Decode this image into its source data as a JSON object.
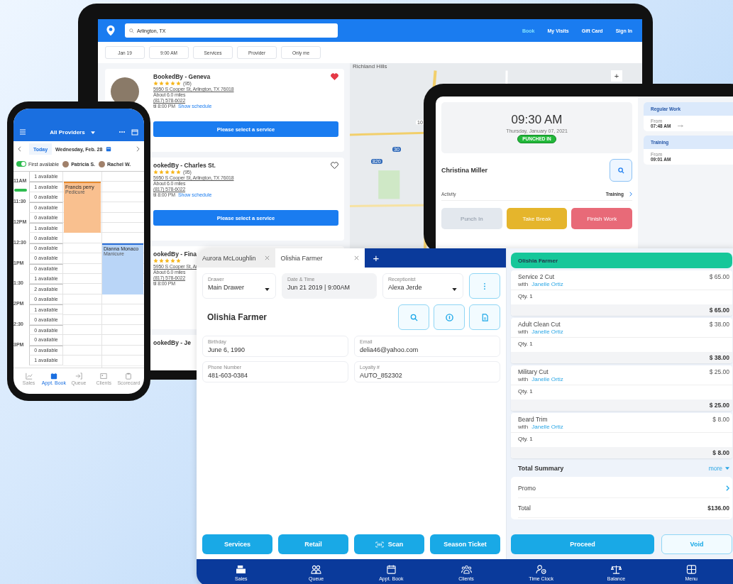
{
  "laptop": {
    "search": {
      "value": "Arlington, TX"
    },
    "nav": [
      {
        "label": "Book",
        "selected": true
      },
      {
        "label": "My Visits",
        "selected": false
      },
      {
        "label": "Gift Card",
        "selected": false
      },
      {
        "label": "Sign In",
        "selected": false
      }
    ],
    "filters": [
      "Jan 19",
      "9:00 AM",
      "Services",
      "Provider",
      "Only me"
    ],
    "listings": [
      {
        "title": "BookedBy - Geneva",
        "stars": 5,
        "reviews": "(95)",
        "address": "5950 S Cooper St, Arlington, TX 76018",
        "distance": "About 6.0 miles",
        "phone": "(817) 578-6022",
        "hours": "til 8:00 PM",
        "schedule": "Show schedule",
        "favorite": true,
        "button": "Please select a service"
      },
      {
        "title": "ookedBy - Charles St.",
        "stars": 5,
        "reviews": "(95)",
        "address": "5950 S Cooper St, Arlington, TX 76018",
        "distance": "About 6.0 miles",
        "phone": "(817) 578-6022",
        "hours": "til 8:00 PM",
        "schedule": "Show schedule",
        "favorite": false,
        "button": "Please select a service"
      },
      {
        "title": "ookedBy - Fina",
        "stars": 5,
        "address": "5950 S Cooper St, Ar",
        "distance": "About 6.0 miles",
        "phone": "(817) 578-6022",
        "hours": "til 8:00 PM"
      },
      {
        "title": "ookedBy - Je"
      }
    ],
    "map": {
      "labels": [
        "Richland Hills",
        "10",
        "30",
        "820"
      ],
      "zoom": "+"
    }
  },
  "phone": {
    "title": "All Providers",
    "today": "Today",
    "date": "Wednesday, Feb. 28",
    "first_available": {
      "label": "First available",
      "on": true
    },
    "providers": [
      "Patricia S.",
      "Rachel W."
    ],
    "rows": [
      {
        "availability": "1 available"
      },
      {
        "time": "11AM",
        "availability": "1 available"
      },
      {
        "availability": "0 available"
      },
      {
        "time": "11:30",
        "availability": "0 available"
      },
      {
        "availability": "0 available"
      },
      {
        "time": "12PM",
        "availability": "1 available"
      },
      {
        "availability": "0 available"
      },
      {
        "time": "12:30",
        "availability": "0 available"
      },
      {
        "availability": "0 available"
      },
      {
        "time": "1PM",
        "availability": "0 available"
      },
      {
        "availability": "1 available"
      },
      {
        "time": "1:30",
        "availability": "2 available"
      },
      {
        "availability": "0 available"
      },
      {
        "time": "2PM",
        "availability": "1 available"
      },
      {
        "availability": "0 available"
      },
      {
        "time": "2:30",
        "availability": "0 available"
      },
      {
        "availability": "0 available"
      },
      {
        "time": "3PM",
        "availability": "0 available"
      },
      {
        "availability": "1 available"
      }
    ],
    "appointments": [
      {
        "name": "Francis perry",
        "service": "Pedicure",
        "color": "#f9c08f"
      },
      {
        "name": "Dianna Monaco",
        "service": "Manicure",
        "color": "#b9d5f7"
      }
    ],
    "tabs": [
      {
        "label": "Sales",
        "selected": false
      },
      {
        "label": "Appt. Book",
        "selected": true
      },
      {
        "label": "Queue",
        "selected": false
      },
      {
        "label": "Clients",
        "selected": false
      },
      {
        "label": "Scorecard",
        "selected": false
      }
    ]
  },
  "tablet": {
    "time": "09:30 AM",
    "date": "Thursday, January 07, 2021",
    "status": "PUNCHED IN",
    "employee": "Christina Miller",
    "activity_label": "Activity",
    "activity": "Training",
    "actions": [
      {
        "label": "Punch In",
        "disabled": true,
        "color": "#e3e8ee"
      },
      {
        "label": "Take Break",
        "disabled": false,
        "color": "#e5b52c"
      },
      {
        "label": "Finish Work",
        "disabled": false,
        "color": "#e86a78"
      }
    ],
    "shifts": [
      {
        "title": "Regular Work",
        "from_label": "From",
        "time": "07:48 AM",
        "arrow": true
      },
      {
        "title": "Training",
        "from_label": "From",
        "time": "09:01 AM",
        "arrow": false
      }
    ]
  },
  "pos": {
    "tabs": [
      {
        "label": "Aurora McLoughlin",
        "selected": false
      },
      {
        "label": "Olishia Farmer",
        "selected": true
      }
    ],
    "add_tab": "+",
    "fields": [
      {
        "label": "Drawer",
        "value": "Main Drawer",
        "kind": "dropdown"
      },
      {
        "label": "Date & Time",
        "value": "Jun 21 2019 | 9:00AM",
        "kind": "readonly"
      },
      {
        "label": "Receptionist",
        "value": "Alexa Jerde",
        "kind": "dropdown"
      }
    ],
    "customer": "Olishia Farmer",
    "info": [
      {
        "label": "Birthday",
        "value": "June 6, 1990"
      },
      {
        "label": "Email",
        "value": "delia46@yahoo.com"
      },
      {
        "label": "Phone Number",
        "value": "481-603-0384"
      },
      {
        "label": "Loyalty #",
        "value": "AUTO_852302"
      }
    ],
    "actions": [
      "Services",
      "Retail",
      "Scan",
      "Season Ticket"
    ],
    "cart": {
      "title": "Olishia Farmer",
      "items": [
        {
          "name": "Service 2 Cut",
          "price": "$ 65.00",
          "with": "with",
          "staff": "Janelle Ortiz",
          "qty": "Qty. 1",
          "subtotal": "$ 65.00"
        },
        {
          "name": "Adult Clean Cut",
          "price": "$ 38.00",
          "with": "with",
          "staff": "Janelle Ortiz",
          "qty": "Qty. 1",
          "subtotal": "$ 38.00"
        },
        {
          "name": "Military Cut",
          "price": "$ 25.00",
          "with": "with",
          "staff": "Janelle Ortiz",
          "qty": "Qty. 1",
          "subtotal": "$ 25.00"
        },
        {
          "name": "Beard Trim",
          "price": "$ 8.00",
          "with": "with",
          "staff": "Janelle Ortiz",
          "qty": "Qty. 1",
          "subtotal": "$ 8.00"
        }
      ],
      "summary": "Total Summary",
      "more": "more",
      "promo": "Promo",
      "total_label": "Total",
      "total": "$136.00"
    },
    "proceed": "Proceed",
    "void": "Void",
    "nav": [
      "Sales",
      "Queue",
      "Appt. Book",
      "Clients",
      "Time Clock",
      "Balance",
      "Menu"
    ]
  }
}
